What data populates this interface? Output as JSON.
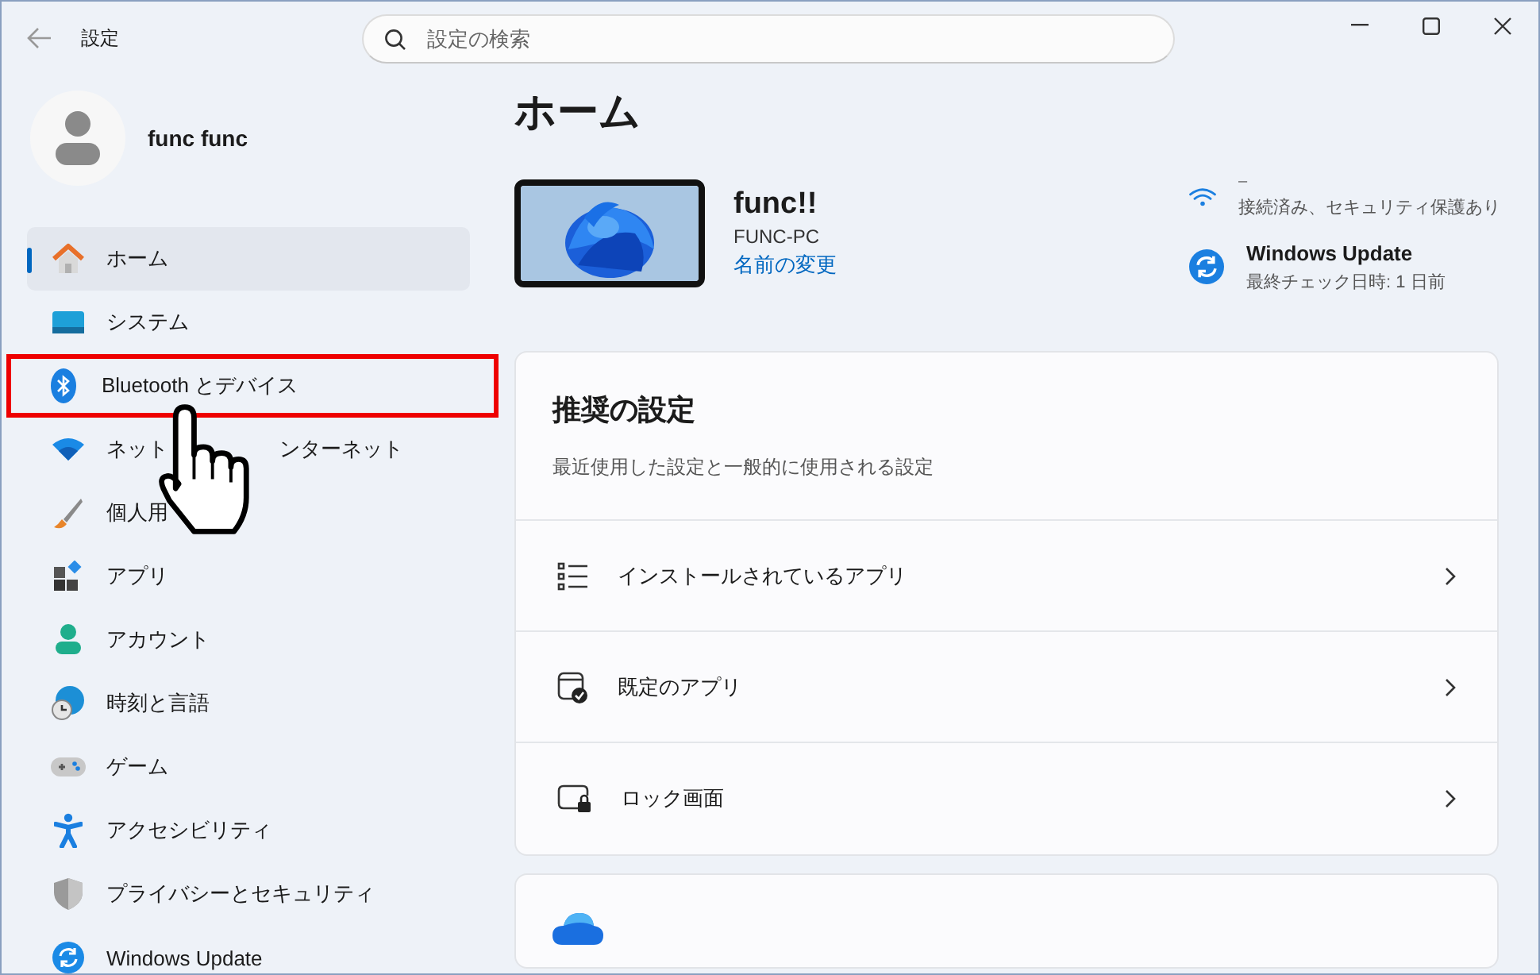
{
  "window": {
    "title": "設定"
  },
  "search": {
    "placeholder": "設定の検索"
  },
  "profile": {
    "name": "func func"
  },
  "nav": [
    {
      "label": "ホーム",
      "selected": true,
      "highlighted": false
    },
    {
      "label": "システム",
      "selected": false,
      "highlighted": false
    },
    {
      "label": "Bluetooth とデバイス",
      "selected": false,
      "highlighted": true
    },
    {
      "label_parts": [
        "ネット",
        "ンターネット"
      ],
      "selected": false,
      "highlighted": false
    },
    {
      "label": "個人用",
      "selected": false,
      "highlighted": false
    },
    {
      "label": "アプリ",
      "selected": false,
      "highlighted": false
    },
    {
      "label": "アカウント",
      "selected": false,
      "highlighted": false
    },
    {
      "label": "時刻と言語",
      "selected": false,
      "highlighted": false
    },
    {
      "label": "ゲーム",
      "selected": false,
      "highlighted": false
    },
    {
      "label": "アクセシビリティ",
      "selected": false,
      "highlighted": false
    },
    {
      "label": "プライバシーとセキュリティ",
      "selected": false,
      "highlighted": false
    },
    {
      "label": "Windows Update",
      "selected": false,
      "highlighted": false
    }
  ],
  "page_title": "ホーム",
  "device": {
    "name": "func!!",
    "model": "FUNC-PC",
    "rename_link": "名前の変更"
  },
  "status": [
    {
      "title": "–",
      "detail": "接続済み、セキュリティ保護あり"
    },
    {
      "title": "Windows Update",
      "detail": "最終チェック日時: 1 日前"
    }
  ],
  "recommended": {
    "title": "推奨の設定",
    "subtitle": "最近使用した設定と一般的に使用される設定",
    "rows": [
      {
        "label": "インストールされているアプリ"
      },
      {
        "label": "既定のアプリ"
      },
      {
        "label": "ロック画面"
      }
    ]
  }
}
